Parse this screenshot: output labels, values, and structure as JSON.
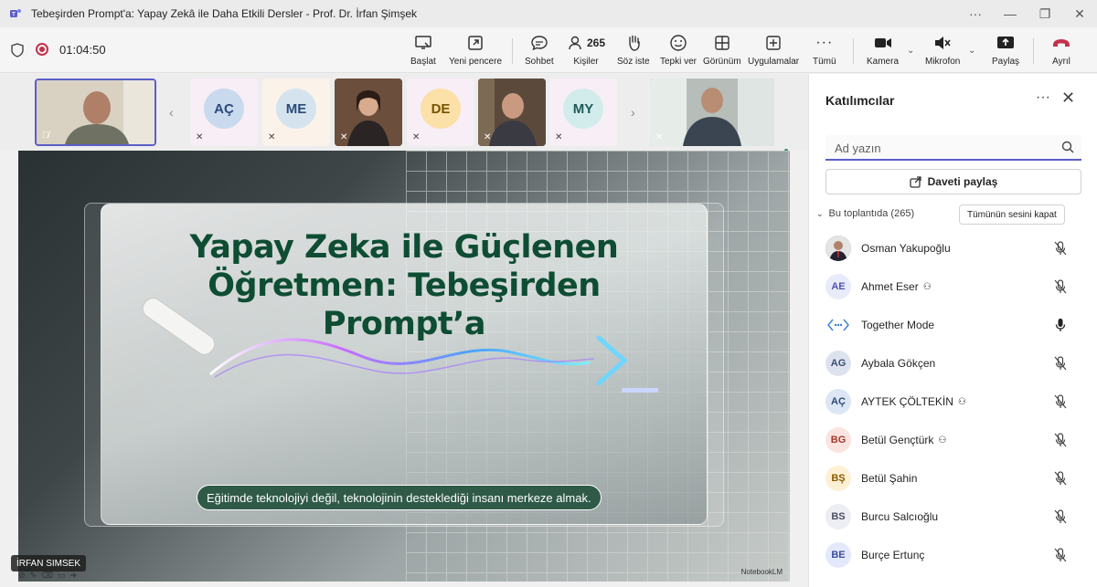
{
  "window": {
    "title": "Tebeşirden Prompt'a: Yapay Zekâ ile Daha Etkili Dersler - Prof. Dr. İrfan Şimşek"
  },
  "meeting": {
    "timer": "01:04:50"
  },
  "toolbar": {
    "buttons": [
      {
        "label": "Başlat",
        "icon": "share-screen-icon"
      },
      {
        "label": "Yeni pencere",
        "icon": "new-window-icon"
      },
      {
        "label": "Sohbet",
        "icon": "chat-icon"
      },
      {
        "label": "Kişiler",
        "icon": "people-icon",
        "count": "265"
      },
      {
        "label": "Söz iste",
        "icon": "raise-hand-icon"
      },
      {
        "label": "Tepki ver",
        "icon": "react-icon"
      },
      {
        "label": "Görünüm",
        "icon": "view-icon"
      },
      {
        "label": "Uygulamalar",
        "icon": "apps-icon"
      },
      {
        "label": "Tümü",
        "icon": "more-icon"
      },
      {
        "label": "Kamera",
        "icon": "camera-icon"
      },
      {
        "label": "Mikrofon",
        "icon": "mic-muted-icon"
      },
      {
        "label": "Paylaş",
        "icon": "share-icon"
      },
      {
        "label": "Ayrıl",
        "icon": "leave-phone-icon"
      }
    ]
  },
  "strip": {
    "tiles": [
      {
        "type": "video",
        "initials": ""
      },
      {
        "type": "avatar",
        "initials": "AÇ",
        "color": "#c9d9ee"
      },
      {
        "type": "avatar",
        "initials": "ME",
        "color": "#d5e3ee"
      },
      {
        "type": "video",
        "initials": ""
      },
      {
        "type": "avatar",
        "initials": "DE",
        "color": "#fbe0a8"
      },
      {
        "type": "video",
        "initials": ""
      },
      {
        "type": "avatar",
        "initials": "MY",
        "color": "#d2ecec"
      },
      {
        "type": "video",
        "initials": ""
      }
    ]
  },
  "slide": {
    "title_line1": "Yapay Zeka ile Güçlenen",
    "title_line2": "Öğretmen: Tebeşirden",
    "title_line3": "Prompt’a",
    "caption": "Eğitimde teknolojiyi değil, teknolojinin desteklediği insanı merkeze almak.",
    "watermark": "NotebookLM",
    "presenter": "İRFAN SIMSEK"
  },
  "panel": {
    "title": "Katılımcılar",
    "search_placeholder": "Ad yazın",
    "invite_label": "Daveti paylaş",
    "section_label": "Bu toplantıda (265)",
    "mute_all_label": "Tümünün sesini kapat",
    "participants": [
      {
        "name": "Osman Yakupoğlu",
        "initials": "",
        "avatar_color": "#6b6b6b",
        "external": false,
        "mic": "muted"
      },
      {
        "name": "Ahmet Eser",
        "initials": "AE",
        "avatar_color": "#e8ebfa",
        "text_color": "#4f52b2",
        "external": true,
        "mic": "muted"
      },
      {
        "name": "Together Mode",
        "initials": "",
        "avatar_color": "#ffffff",
        "external": false,
        "mic": "on"
      },
      {
        "name": "Aybala Gökçen",
        "initials": "AG",
        "avatar_color": "#dde3ee",
        "text_color": "#3a4c6e",
        "external": false,
        "mic": "muted"
      },
      {
        "name": "AYTEK ÇÖLTEKİN",
        "initials": "AÇ",
        "avatar_color": "#dce6f4",
        "text_color": "#2b4a7a",
        "external": true,
        "mic": "muted"
      },
      {
        "name": "Betül Gençtürk",
        "initials": "BG",
        "avatar_color": "#fbe4e0",
        "text_color": "#a33a2b",
        "external": true,
        "mic": "muted"
      },
      {
        "name": "Betül Şahin",
        "initials": "BŞ",
        "avatar_color": "#fdf0d5",
        "text_color": "#8a5a00",
        "external": false,
        "mic": "muted"
      },
      {
        "name": "Burcu Salcıoğlu",
        "initials": "BS",
        "avatar_color": "#eceef3",
        "text_color": "#4a5060",
        "external": false,
        "mic": "muted"
      },
      {
        "name": "Burçe Ertunç",
        "initials": "BE",
        "avatar_color": "#e3e9fb",
        "text_color": "#3b4fa0",
        "external": false,
        "mic": "muted"
      }
    ]
  },
  "colors": {
    "accent": "#5b5fc7",
    "record": "#c4314b",
    "slide_title": "#0e4d33",
    "leave": "#c4314b"
  }
}
